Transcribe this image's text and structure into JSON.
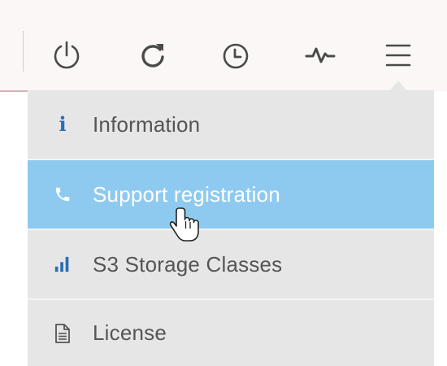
{
  "toolbar": {
    "icons": [
      "power-icon",
      "refresh-icon",
      "clock-icon",
      "activity-icon",
      "menu-icon"
    ]
  },
  "menu": {
    "items": [
      {
        "label": "Information",
        "icon": "info-icon"
      },
      {
        "label": "Support registration",
        "icon": "phone-icon",
        "active": true
      },
      {
        "label": "S3 Storage Classes",
        "icon": "bar-chart-icon"
      },
      {
        "label": "License",
        "icon": "document-icon"
      }
    ],
    "colors": {
      "active_background": "#8ecaf0",
      "item_background": "#e6e6e6",
      "icon_blue": "#2a6fb5",
      "label_text": "#555555"
    }
  }
}
